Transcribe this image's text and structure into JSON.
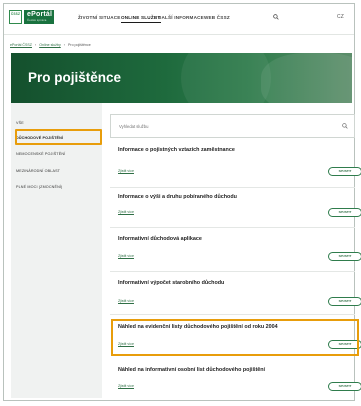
{
  "header": {
    "cssz_logo": "ČSSZ",
    "eportal_logo": "ePortál",
    "eportal_sub": "Česká správa",
    "nav": [
      "ŽIVOTNÍ SITUACE",
      "ONLINE SLUŽBY",
      "DALŠÍ INFORMACE",
      "WEB ČSSZ"
    ],
    "lang": "CZ"
  },
  "breadcrumb": [
    "ePortál ČSSZ",
    "Online služby",
    "Pro pojištěnce"
  ],
  "hero": {
    "title": "Pro pojištěnce"
  },
  "sidebar": {
    "items": [
      "VŠE",
      "DŮCHODOVÉ POJIŠTĚNÍ",
      "NEMOCENSKÉ POJIŠTĚNÍ",
      "MEZINÁRODNÍ OBLAST",
      "PLNÉ MOCI (ZMOCNĚNÍ)"
    ],
    "active_index": 1
  },
  "search": {
    "placeholder": "Vyhledat službu"
  },
  "cards": [
    {
      "title": "Informace o pojistných vztazích zaměstnance",
      "more": "Zjistit více",
      "button": "SPUSTIT"
    },
    {
      "title": "Informace o výši a druhu pobíraného důchodu",
      "more": "Zjistit více",
      "button": "SPUSTIT"
    },
    {
      "title": "Informativní důchodová aplikace",
      "more": "Zjistit více",
      "button": "SPUSTIT"
    },
    {
      "title": "Informativní výpočet starobního důchodu",
      "more": "Zjistit více",
      "button": "SPUSTIT"
    },
    {
      "title": "Náhled na evidenční listy důchodového pojištění od roku 2004",
      "more": "Zjistit více",
      "button": "SPUSTIT"
    },
    {
      "title": "Náhled na informativní osobní list důchodového pojištění",
      "more": "Zjistit více",
      "button": "SPUSTIT"
    }
  ],
  "colors": {
    "brand_green": "#19723f",
    "highlight": "#e89d0b"
  },
  "icons": {
    "search": "search-icon",
    "logo": "cssz-logo-icon"
  }
}
